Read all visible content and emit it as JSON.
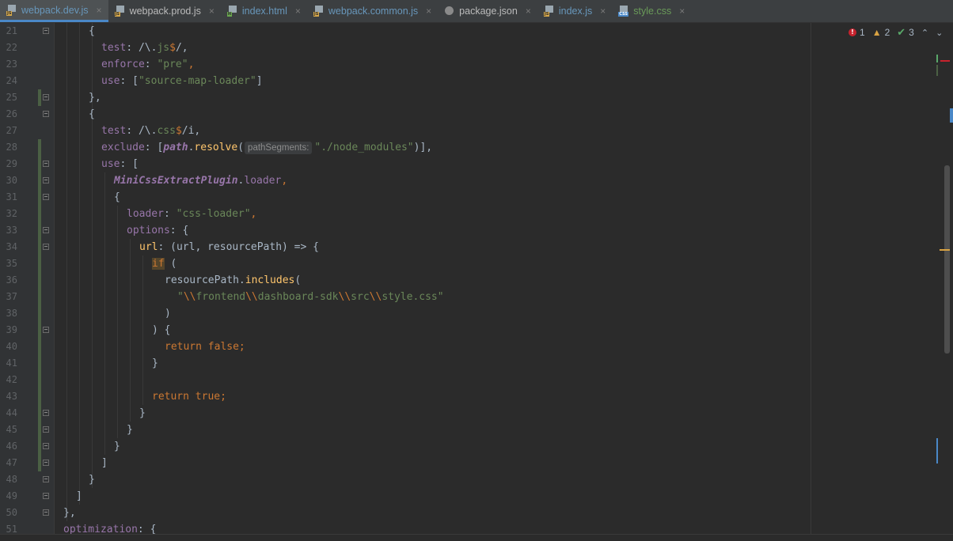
{
  "tabs": [
    {
      "label": "webpack.dev.js",
      "icon": "js-file-icon",
      "active": true,
      "style": "mod"
    },
    {
      "label": "webpack.prod.js",
      "icon": "js-file-icon",
      "active": false,
      "style": "js"
    },
    {
      "label": "index.html",
      "icon": "html-file-icon",
      "active": false,
      "style": "html"
    },
    {
      "label": "webpack.common.js",
      "icon": "js-file-icon",
      "active": false,
      "style": "mod"
    },
    {
      "label": "package.json",
      "icon": "package-json-icon",
      "active": false,
      "style": "js"
    },
    {
      "label": "index.js",
      "icon": "js-file-icon",
      "active": false,
      "style": "mod"
    },
    {
      "label": "style.css",
      "icon": "css-file-icon",
      "active": false,
      "style": "css"
    }
  ],
  "file_icon_labels": {
    "js": "JS",
    "html": "H",
    "css": "CSS"
  },
  "close_glyph": "×",
  "inspections": {
    "errors": "1",
    "warnings": "2",
    "ok": "3"
  },
  "line_numbers": [
    "21",
    "22",
    "23",
    "24",
    "25",
    "26",
    "27",
    "28",
    "29",
    "30",
    "31",
    "32",
    "33",
    "34",
    "35",
    "36",
    "37",
    "38",
    "39",
    "40",
    "41",
    "42",
    "43",
    "44",
    "45",
    "46",
    "47",
    "48",
    "49",
    "50",
    "51"
  ],
  "code": {
    "l21": "{",
    "l22_a": "test",
    "l22_b": ": /\\.",
    "l22_c": "js",
    "l22_d": "$",
    "l22_e": "/,",
    "l23_a": "enforce",
    "l23_b": ": ",
    "l23_c": "\"pre\"",
    "l23_d": ",",
    "l24_a": "use",
    "l24_b": ": [",
    "l24_c": "\"source-map-loader\"",
    "l24_d": "]",
    "l25": "},",
    "l26": "{",
    "l27_a": "test",
    "l27_b": ": /\\.",
    "l27_c": "css",
    "l27_d": "$",
    "l27_e": "/i,",
    "l28_a": "exclude",
    "l28_b": ": [",
    "l28_c": "path",
    "l28_d": ".",
    "l28_e": "resolve",
    "l28_f": "(",
    "l28_hint": "pathSegments:",
    "l28_g": "\"./node_modules\"",
    "l28_h": ")],",
    "l29_a": "use",
    "l29_b": ": [",
    "l30_a": "MiniCssExtractPlugin",
    "l30_b": ".",
    "l30_c": "loader",
    "l30_d": ",",
    "l31": "{",
    "l32_a": "loader",
    "l32_b": ": ",
    "l32_c": "\"css-loader\"",
    "l32_d": ",",
    "l33_a": "options",
    "l33_b": ": {",
    "l34_a": "url",
    "l34_b": ": (url, resourcePath) => {",
    "l35_a": "if",
    "l35_b": " (",
    "l36_a": "resourcePath.",
    "l36_b": "includes",
    "l36_c": "(",
    "l37_a": "\"",
    "l37_b": "\\\\",
    "l37_c": "frontend",
    "l37_d": "\\\\",
    "l37_e": "dashboard-sdk",
    "l37_f": "\\\\",
    "l37_g": "src",
    "l37_h": "\\\\",
    "l37_i": "style.css\"",
    "l38": ")",
    "l39": ") {",
    "l40_a": "return false",
    "l40_b": ";",
    "l41": "}",
    "l43_a": "return true",
    "l43_b": ";",
    "l44": "}",
    "l45": "}",
    "l46": "}",
    "l47": "]",
    "l48": "}",
    "l49": "]",
    "l50": "},",
    "l51_a": "optimization",
    "l51_b": ": {"
  },
  "colors": {
    "background": "#2b2b2b",
    "keyword": "#cc7832",
    "property": "#9876aa",
    "string": "#6a8759",
    "function": "#ffc66d",
    "text": "#a9b7c6"
  }
}
